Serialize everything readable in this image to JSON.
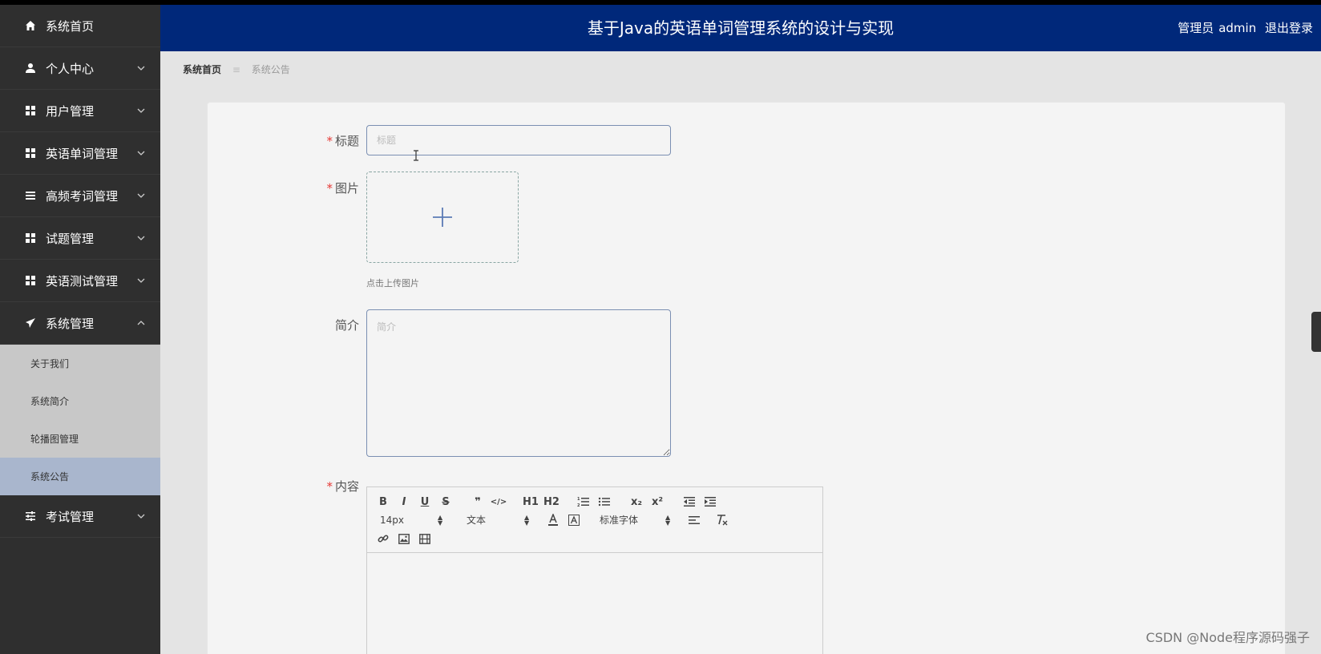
{
  "header": {
    "title": "基于Java的英语单词管理系统的设计与实现",
    "role": "管理员",
    "username": "admin",
    "logout": "退出登录"
  },
  "sidebar": {
    "items": [
      {
        "label": "系统首页",
        "icon": "home-icon"
      },
      {
        "label": "个人中心",
        "icon": "user-icon"
      },
      {
        "label": "用户管理",
        "icon": "grid-icon"
      },
      {
        "label": "英语单词管理",
        "icon": "grid-icon"
      },
      {
        "label": "高频考词管理",
        "icon": "list-icon"
      },
      {
        "label": "试题管理",
        "icon": "grid-icon"
      },
      {
        "label": "英语测试管理",
        "icon": "grid-icon"
      },
      {
        "label": "系统管理",
        "icon": "paper-plane-icon"
      },
      {
        "label": "考试管理",
        "icon": "sliders-icon"
      }
    ],
    "submenu": [
      {
        "label": "关于我们"
      },
      {
        "label": "系统简介"
      },
      {
        "label": "轮播图管理"
      },
      {
        "label": "系统公告",
        "active": true
      }
    ]
  },
  "breadcrumb": {
    "home": "系统首页",
    "separator": "≡",
    "current": "系统公告"
  },
  "form": {
    "title_label": "标题",
    "title_placeholder": "标题",
    "image_label": "图片",
    "upload_hint": "点击上传图片",
    "intro_label": "简介",
    "intro_placeholder": "简介",
    "content_label": "内容",
    "required_mark": "*"
  },
  "editor": {
    "font_size": "14px",
    "paragraph": "文本",
    "font_family": "标准字体",
    "buttons": [
      "B",
      "I",
      "U",
      "S",
      "❞",
      "</>",
      "H1",
      "H2",
      "x₂",
      "x²"
    ]
  },
  "watermark": "CSDN @Node程序源码强子",
  "colors": {
    "header_bg": "#00287a",
    "sidebar_bg": "#2f2f2f",
    "submenu_bg": "#c8c8c8",
    "submenu_active": "#a9b6cd",
    "required": "#e53935"
  }
}
